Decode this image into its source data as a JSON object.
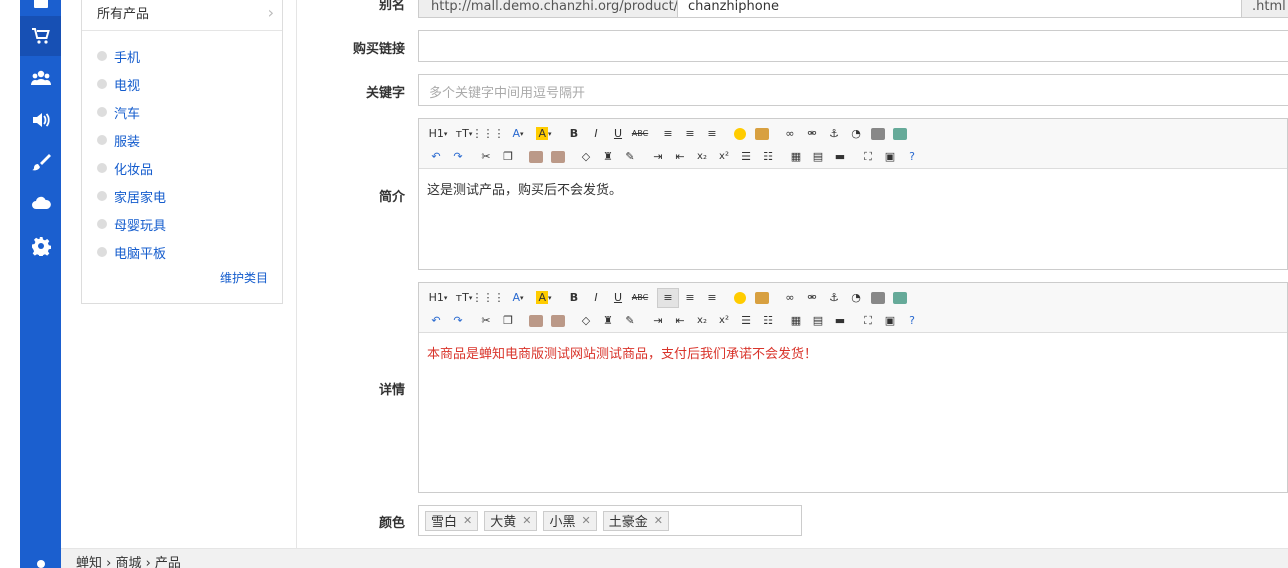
{
  "nav": {
    "items": [
      {
        "icon": "list-icon"
      },
      {
        "icon": "shopping-cart-icon",
        "active": true
      },
      {
        "icon": "users-icon"
      },
      {
        "icon": "volume-icon"
      },
      {
        "icon": "brush-icon"
      },
      {
        "icon": "cloud-icon"
      },
      {
        "icon": "gear-icon"
      },
      {
        "icon": "user-icon"
      }
    ]
  },
  "categories": {
    "header": "所有产品",
    "items": [
      "手机",
      "电视",
      "汽车",
      "服装",
      "化妆品",
      "家居家电",
      "母婴玩具",
      "电脑平板"
    ],
    "maintain": "维护类目"
  },
  "form": {
    "alias_label": "别名",
    "alias_prefix": "http://mall.demo.chanzhi.org/product/id_",
    "alias_value": "chanzhiphone",
    "alias_suffix": ".html",
    "buylink_label": "购买链接",
    "buylink_value": "",
    "keywords_label": "关键字",
    "keywords_placeholder": "多个关键字中间用逗号隔开",
    "summary_label": "简介",
    "summary_text": "这是测试产品，购买后不会发货。",
    "detail_label": "详情",
    "detail_text": "本商品是蝉知电商版测试网站测试商品，支付后我们承诺不会发货！",
    "color_label": "颜色",
    "colors": [
      "雪白",
      "大黄",
      "小黑",
      "土豪金"
    ]
  },
  "toolbar": {
    "row1": [
      "H1",
      "тT",
      "⋯",
      "A",
      "A",
      "B",
      "I",
      "U",
      "ABC"
    ],
    "row2": [
      "x₂",
      "x²"
    ]
  },
  "breadcrumb": "蝉知 › 商城 › 产品",
  "colors": {
    "nav_bg": "#1b5fcf",
    "link": "#145ccd",
    "detail_text": "#d9342b"
  }
}
